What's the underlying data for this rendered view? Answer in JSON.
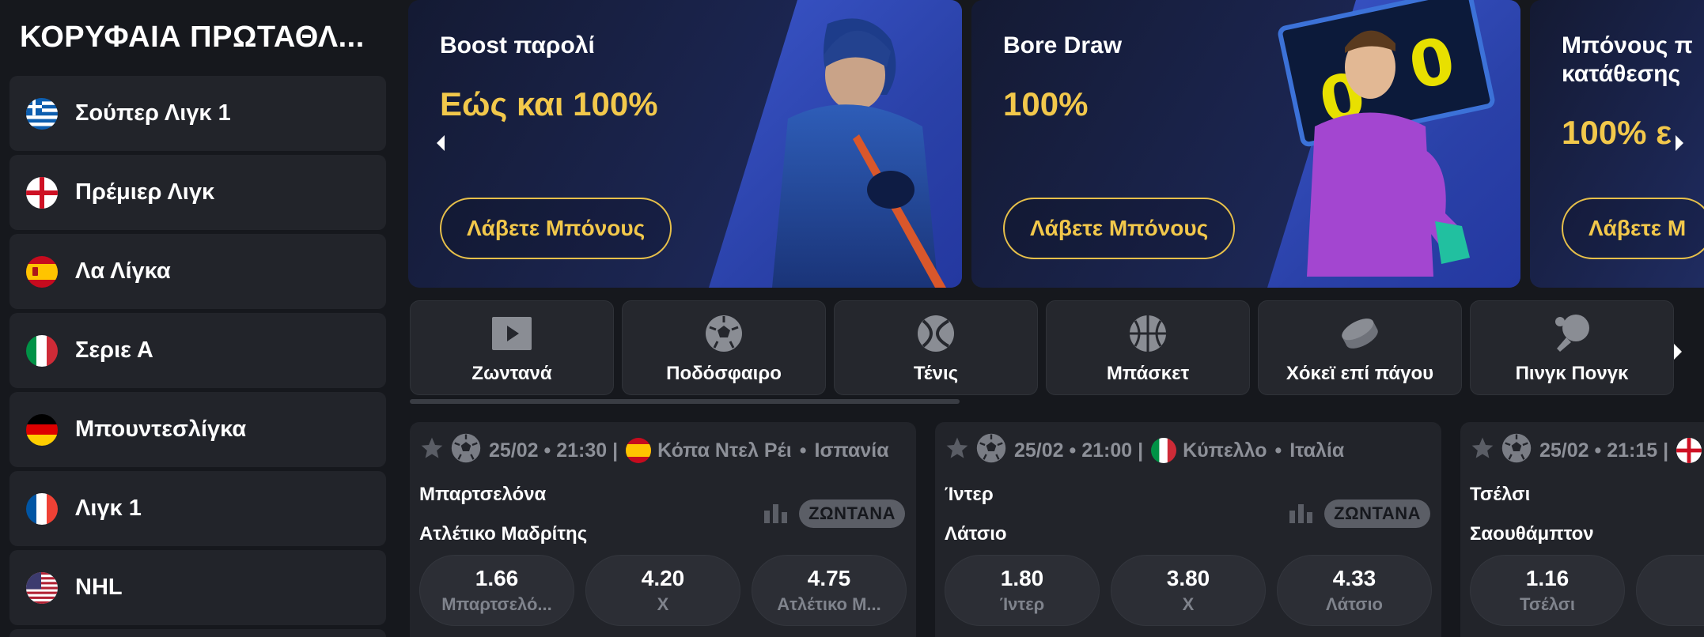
{
  "sidebar": {
    "title": "ΚΟΡΥΦΑΙΑ ΠΡΩΤΑΘΛ...",
    "leagues": [
      {
        "name": "Σούπερ Λιγκ 1",
        "flag": "greece-flag-icon"
      },
      {
        "name": "Πρέμιερ Λιγκ",
        "flag": "england-flag-icon"
      },
      {
        "name": "Λα Λίγκα",
        "flag": "spain-flag-icon"
      },
      {
        "name": "Σεριε Α",
        "flag": "italy-flag-icon"
      },
      {
        "name": "Μπουντεσλίγκα",
        "flag": "germany-flag-icon"
      },
      {
        "name": "Λιγκ 1",
        "flag": "france-flag-icon"
      },
      {
        "name": "NHL",
        "flag": "usa-flag-icon"
      }
    ]
  },
  "banners": [
    {
      "title": "Boost παρολί",
      "amount": "Εώς και 100%",
      "button": "Λάβετε Μπόνους",
      "art": "hockey-player-image"
    },
    {
      "title": "Bore Draw",
      "amount": "100%",
      "button": "Λάβετε Μπόνους",
      "art": "goalkeeper-scoreboard-image"
    },
    {
      "title_line1": "Μπόνους π",
      "title_line2": "κατάθεσης",
      "amount": "100% ε",
      "button": "Λάβετε Μ"
    }
  ],
  "sports": [
    {
      "label": "Ζωντανά",
      "icon": "live-play-icon"
    },
    {
      "label": "Ποδόσφαιρο",
      "icon": "soccer-ball-icon"
    },
    {
      "label": "Τένις",
      "icon": "tennis-ball-icon"
    },
    {
      "label": "Μπάσκετ",
      "icon": "basketball-icon"
    },
    {
      "label": "Χόκεϊ επί πάγου",
      "icon": "hockey-puck-icon"
    },
    {
      "label": "Πινγκ Πονγκ",
      "icon": "ping-pong-icon"
    }
  ],
  "matches": [
    {
      "datetime": "25/02 • 21:30 |",
      "competition": "Κόπα Ντελ Ρέι",
      "country": "Ισπανία",
      "flag": "spain-flag-icon",
      "home": "Μπαρτσελόνα",
      "away": "Ατλέτικο Μαδρίτης",
      "live": "ΖΩΝΤΑΝΑ",
      "odds": [
        {
          "value": "1.66",
          "label": "Μπαρτσελό..."
        },
        {
          "value": "4.20",
          "label": "X"
        },
        {
          "value": "4.75",
          "label": "Ατλέτικο Μ..."
        }
      ]
    },
    {
      "datetime": "25/02 • 21:00 |",
      "competition": "Κύπελλο",
      "country": "Ιταλία",
      "flag": "italy-flag-icon",
      "home": "Ίντερ",
      "away": "Λάτσιο",
      "live": "ΖΩΝΤΑΝΑ",
      "odds": [
        {
          "value": "1.80",
          "label": "Ίντερ"
        },
        {
          "value": "3.80",
          "label": "X"
        },
        {
          "value": "4.33",
          "label": "Λάτσιο"
        }
      ]
    },
    {
      "datetime": "25/02 • 21:15 |",
      "flag": "england-flag-icon",
      "home": "Τσέλσι",
      "away": "Σαουθάμπτον",
      "odds": [
        {
          "value": "1.16",
          "label": "Τσέλσι"
        }
      ]
    }
  ],
  "colors": {
    "accent_gold": "#f2c84b",
    "background": "#16181d",
    "card": "#22242a",
    "banner_blue": "#2a41a8"
  }
}
